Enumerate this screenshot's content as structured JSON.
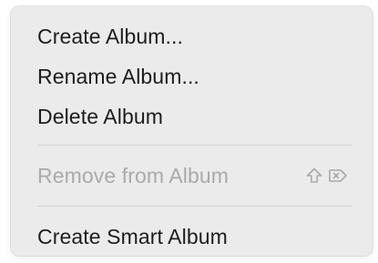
{
  "menu": {
    "items": [
      {
        "label": "Create Album...",
        "enabled": true
      },
      {
        "label": "Rename Album...",
        "enabled": true
      },
      {
        "label": "Delete Album",
        "enabled": true
      },
      {
        "label": "Remove from Album",
        "enabled": false,
        "shortcut_icons": [
          "shift-icon",
          "delete-forward-icon"
        ]
      },
      {
        "label": "Create Smart Album",
        "enabled": true
      }
    ]
  },
  "colors": {
    "menu_background": "#ebebeb",
    "text": "#1d1d1f",
    "disabled_text": "#aaaaaa",
    "separator": "#d3d3d3"
  }
}
